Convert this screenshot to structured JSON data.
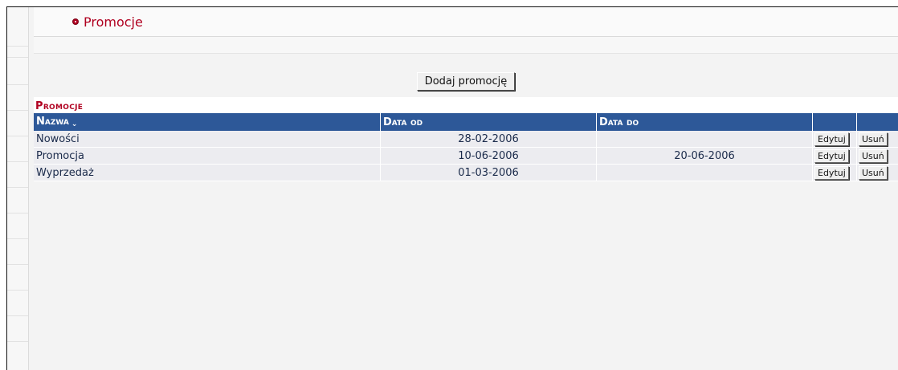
{
  "header": {
    "title": "Promocje"
  },
  "toolbar": {
    "add_label": "Dodaj promocję"
  },
  "panel": {
    "title": "Promocje",
    "columns": [
      "Nazwa",
      "Data od",
      "Data do",
      "",
      ""
    ],
    "rows": [
      {
        "name": "Nowości",
        "date_from": "28-02-2006",
        "date_to": "",
        "edit": "Edytuj",
        "delete": "Usuń"
      },
      {
        "name": "Promocja",
        "date_from": "10-06-2006",
        "date_to": "20-06-2006",
        "edit": "Edytuj",
        "delete": "Usuń"
      },
      {
        "name": "Wyprzedaż",
        "date_from": "01-03-2006",
        "date_to": "",
        "edit": "Edytuj",
        "delete": "Usuń"
      }
    ]
  },
  "colors": {
    "accent": "#b00020",
    "header_bg": "#2d5898",
    "row_bg": "#ececf0"
  },
  "icons": {
    "title_bullet": "bullet-icon",
    "sort": "sort-caret-icon"
  }
}
